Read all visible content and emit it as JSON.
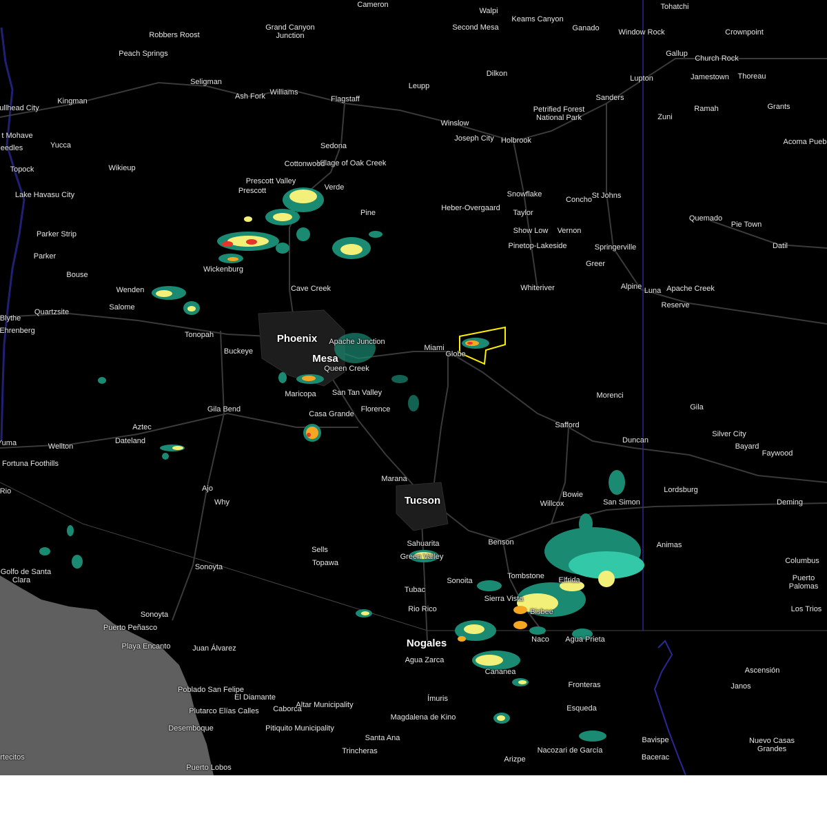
{
  "map": {
    "background_color": "#000000",
    "ocean_color": "#5f5f5f",
    "road_color": "#3a3a3a",
    "state_line_color": "#3b3bd6",
    "warning_polygon_color": "#ffee00",
    "echo_colors": {
      "light": "#1a8a73",
      "moderate": "#32c8a8",
      "heavy": "#f3f07a",
      "intense": "#f5a623",
      "severe": "#e8332a"
    }
  },
  "places": [
    {
      "name": "Cameron"
    },
    {
      "name": "Walpi"
    },
    {
      "name": "Keams Canyon"
    },
    {
      "name": "Second Mesa"
    },
    {
      "name": "Tohatchi"
    },
    {
      "name": "Ganado"
    },
    {
      "name": "Window Rock"
    },
    {
      "name": "Crownpoint"
    },
    {
      "name": "Robbers Roost"
    },
    {
      "name": "Grand Canyon Junction"
    },
    {
      "name": "Peach Springs"
    },
    {
      "name": "Gallup"
    },
    {
      "name": "Church Rock"
    },
    {
      "name": "Jamestown"
    },
    {
      "name": "Thoreau"
    },
    {
      "name": "Dilkon"
    },
    {
      "name": "Lupton"
    },
    {
      "name": "Seligman"
    },
    {
      "name": "Ash Fork"
    },
    {
      "name": "Williams"
    },
    {
      "name": "Flagstaff"
    },
    {
      "name": "Leupp"
    },
    {
      "name": "Kingman"
    },
    {
      "name": "ullhead City"
    },
    {
      "name": "Sanders"
    },
    {
      "name": "Ramah"
    },
    {
      "name": "Grants"
    },
    {
      "name": "Petrified Forest National Park"
    },
    {
      "name": "Winslow"
    },
    {
      "name": "Zuni"
    },
    {
      "name": "t Mohave"
    },
    {
      "name": "Joseph City"
    },
    {
      "name": "Holbrook"
    },
    {
      "name": "Acoma Pueb"
    },
    {
      "name": "eedles"
    },
    {
      "name": "Yucca"
    },
    {
      "name": "Sedona"
    },
    {
      "name": "Village of Oak Creek"
    },
    {
      "name": "Cottonwood"
    },
    {
      "name": "Topock"
    },
    {
      "name": "Wikieup"
    },
    {
      "name": "Prescott Valley"
    },
    {
      "name": "Verde"
    },
    {
      "name": "Prescott"
    },
    {
      "name": "Lake Havasu City"
    },
    {
      "name": "Snowflake"
    },
    {
      "name": "Concho"
    },
    {
      "name": "St Johns"
    },
    {
      "name": "Heber-Overgaard"
    },
    {
      "name": "Taylor"
    },
    {
      "name": "Pine"
    },
    {
      "name": "Quemado"
    },
    {
      "name": "Pie Town"
    },
    {
      "name": "Show Low"
    },
    {
      "name": "Vernon"
    },
    {
      "name": "Parker Strip"
    },
    {
      "name": "Pinetop-Lakeside"
    },
    {
      "name": "Springerville"
    },
    {
      "name": "Datil"
    },
    {
      "name": "Parker"
    },
    {
      "name": "Wickenburg"
    },
    {
      "name": "Greer"
    },
    {
      "name": "Bouse"
    },
    {
      "name": "Whiteriver"
    },
    {
      "name": "Alpine"
    },
    {
      "name": "Luna"
    },
    {
      "name": "Apache Creek"
    },
    {
      "name": "Wenden"
    },
    {
      "name": "Cave Creek"
    },
    {
      "name": "Salome"
    },
    {
      "name": "Reserve"
    },
    {
      "name": "Quartzsite"
    },
    {
      "name": "Blythe"
    },
    {
      "name": "Ehrenberg"
    },
    {
      "name": "Tonopah"
    },
    {
      "name": "Phoenix"
    },
    {
      "name": "Apache Junction"
    },
    {
      "name": "Buckeye"
    },
    {
      "name": "Mesa"
    },
    {
      "name": "Miami"
    },
    {
      "name": "Globe"
    },
    {
      "name": "Queen Creek"
    },
    {
      "name": "San Tan Valley"
    },
    {
      "name": "Maricopa"
    },
    {
      "name": "Morenci"
    },
    {
      "name": "Gila Bend"
    },
    {
      "name": "Florence"
    },
    {
      "name": "Casa Grande"
    },
    {
      "name": "Gila"
    },
    {
      "name": "Aztec"
    },
    {
      "name": "Safford"
    },
    {
      "name": "Silver City"
    },
    {
      "name": "Dateland"
    },
    {
      "name": "Duncan"
    },
    {
      "name": "Wellton"
    },
    {
      "name": "Bayard"
    },
    {
      "name": "Yuma"
    },
    {
      "name": "Faywood"
    },
    {
      "name": "Fortuna Foothills"
    },
    {
      "name": "Marana"
    },
    {
      "name": "Rio"
    },
    {
      "name": "Ajo"
    },
    {
      "name": "Lordsburg"
    },
    {
      "name": "Bowie"
    },
    {
      "name": "Tucson"
    },
    {
      "name": "Why"
    },
    {
      "name": "San Simon"
    },
    {
      "name": "Deming"
    },
    {
      "name": "Willcox"
    },
    {
      "name": "Benson"
    },
    {
      "name": "Animas"
    },
    {
      "name": "Sahuarita"
    },
    {
      "name": "Green Valley"
    },
    {
      "name": "Sells"
    },
    {
      "name": "Topawa"
    },
    {
      "name": "Columbus"
    },
    {
      "name": "Sonoyta"
    },
    {
      "name": "Tombstone"
    },
    {
      "name": "El Golfo de Santa Clara"
    },
    {
      "name": "Elfrida"
    },
    {
      "name": "Puerto Palomas"
    },
    {
      "name": "Sonoita"
    },
    {
      "name": "Tubac"
    },
    {
      "name": "Sierra Vista"
    },
    {
      "name": "Los Trios"
    },
    {
      "name": "Rio Rico"
    },
    {
      "name": "Bisbee"
    },
    {
      "name": "Sonoyta"
    },
    {
      "name": "Puerto Peñasco"
    },
    {
      "name": "Playa Encanto"
    },
    {
      "name": "Nogales"
    },
    {
      "name": "Naco"
    },
    {
      "name": "Agua Prieta"
    },
    {
      "name": "Juan Álvarez"
    },
    {
      "name": "Agua Zarca"
    },
    {
      "name": "Cananea"
    },
    {
      "name": "Ascensión"
    },
    {
      "name": "Janos"
    },
    {
      "name": "Fronteras"
    },
    {
      "name": "Poblado San Felipe"
    },
    {
      "name": "El Diamante"
    },
    {
      "name": "Altar Municipality"
    },
    {
      "name": "Plutarco Elías Calles"
    },
    {
      "name": "Caborca"
    },
    {
      "name": "Ímuris"
    },
    {
      "name": "Esqueda"
    },
    {
      "name": "Pitiquito Municipality"
    },
    {
      "name": "Magdalena de Kino"
    },
    {
      "name": "Desemboque"
    },
    {
      "name": "Santa Ana"
    },
    {
      "name": "Bavispe"
    },
    {
      "name": "Nuevo Casas Grandes"
    },
    {
      "name": "Nacozari de García"
    },
    {
      "name": "Trincheras"
    },
    {
      "name": "Bacerac"
    },
    {
      "name": "rtecitos"
    },
    {
      "name": "Arizpe"
    },
    {
      "name": "Puerto Lobos"
    }
  ]
}
